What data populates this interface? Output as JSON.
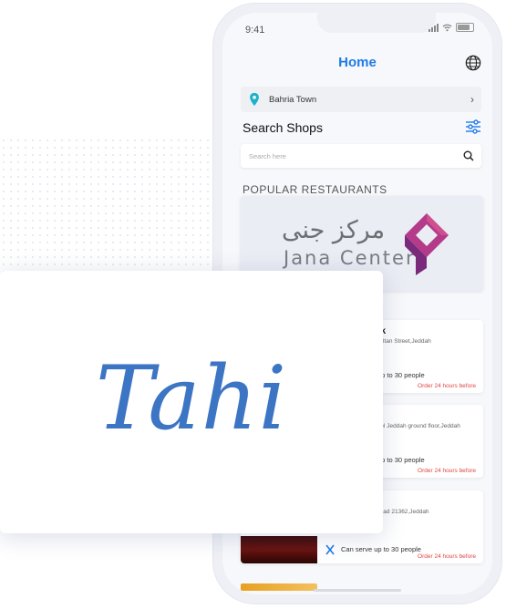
{
  "status_bar": {
    "time": "9:41"
  },
  "header": {
    "title": "Home",
    "globe_icon": "globe-icon"
  },
  "location": {
    "text": "Bahria Town",
    "pin_icon": "location-pin-icon",
    "accent": "#1bb3c9"
  },
  "search": {
    "title": "Search Shops",
    "placeholder": "Search here"
  },
  "section": {
    "popular_title": "POPULAR RESTAURANTS"
  },
  "banner": {
    "arabic_text": "مركز جنى",
    "english_text": "Jana Center",
    "logo_colors": [
      "#b43a8a",
      "#7a2a7a"
    ]
  },
  "restaurants": [
    {
      "name": "ck",
      "address": "Sultan Street,Jeddah",
      "rating": ")",
      "serve": "up to 30 people",
      "order": "Order 24 hours before"
    },
    {
      "name": "",
      "address": "atel Jeddah ground floor,Jeddah",
      "rating": ")",
      "serve": "up to 30 people",
      "order": "Order 24 hours before"
    },
    {
      "name": "",
      "address": "Road 21362,Jeddah",
      "rating": ")",
      "serve": "Can serve up to 30 people",
      "order": "Order 24 hours before"
    }
  ],
  "overlay": {
    "brand": "Tahi",
    "brand_color": "#3c75c4"
  },
  "colors": {
    "accent": "#1d7be8",
    "order_note": "#e04545"
  }
}
